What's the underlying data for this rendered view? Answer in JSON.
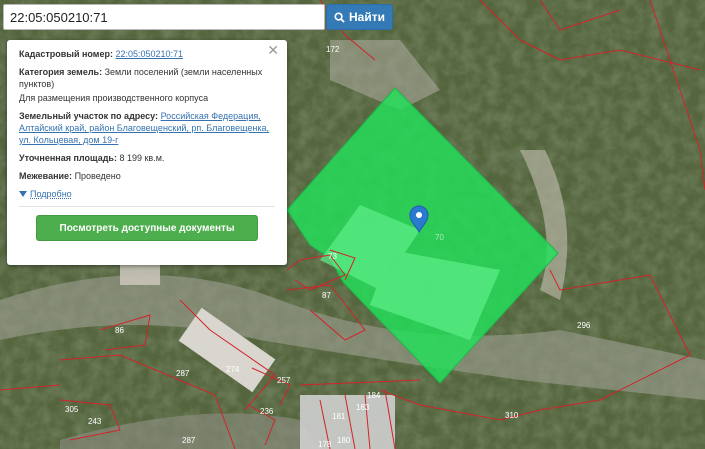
{
  "search": {
    "value": "22:05:050210:71",
    "button_label": "Найти"
  },
  "popup": {
    "cadastral_label": "Кадастровый номер:",
    "cadastral_number": "22:05:050210:71",
    "category_label": "Категория земель:",
    "category_value": "Земли поселений (земли населенных пунктов)",
    "usage": "Для размещения производственного корпуса",
    "address_label": "Земельный участок по адресу:",
    "address_value": "Российская Федерация, Алтайский край, район Благовещенский, рп. Благовещенка, ул. Кольцевая, дом 19-г",
    "area_label": "Уточненная площадь:",
    "area_value": "8 199 кв.м.",
    "survey_label": "Межевание:",
    "survey_value": "Проведено",
    "more_label": "Подробно",
    "docs_button": "Посмотреть доступные документы"
  },
  "map": {
    "highlight_color": "#22e05a",
    "parcel_labels": {
      "p172": "172",
      "p70": "70",
      "p73": "73",
      "p87": "87",
      "p86": "86",
      "p274": "274",
      "p257": "257",
      "p287a": "287",
      "p287b": "287",
      "p305": "305",
      "p243": "243",
      "p296": "296",
      "p310": "310",
      "p184": "184",
      "p183": "183",
      "p181": "181",
      "p180": "180",
      "p178": "178",
      "p236": "236"
    }
  }
}
